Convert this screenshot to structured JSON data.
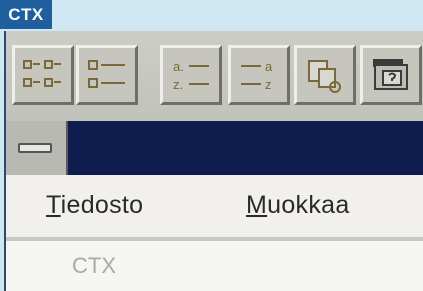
{
  "badge": {
    "label": "CTX"
  },
  "toolbar": {
    "buttons": [
      {
        "icon": "large-icons-view-icon"
      },
      {
        "icon": "list-view-icon"
      },
      {
        "icon": "sort-ascending-icon"
      },
      {
        "icon": "sort-descending-icon"
      },
      {
        "icon": "find-icon"
      },
      {
        "icon": "properties-icon"
      }
    ]
  },
  "titlebar": {
    "color": "#0e1c4e"
  },
  "menu": {
    "items": [
      {
        "accel": "T",
        "rest": "iedosto"
      },
      {
        "accel": "M",
        "rest": "uokkaa"
      }
    ]
  },
  "content": {
    "label": "CTX"
  }
}
